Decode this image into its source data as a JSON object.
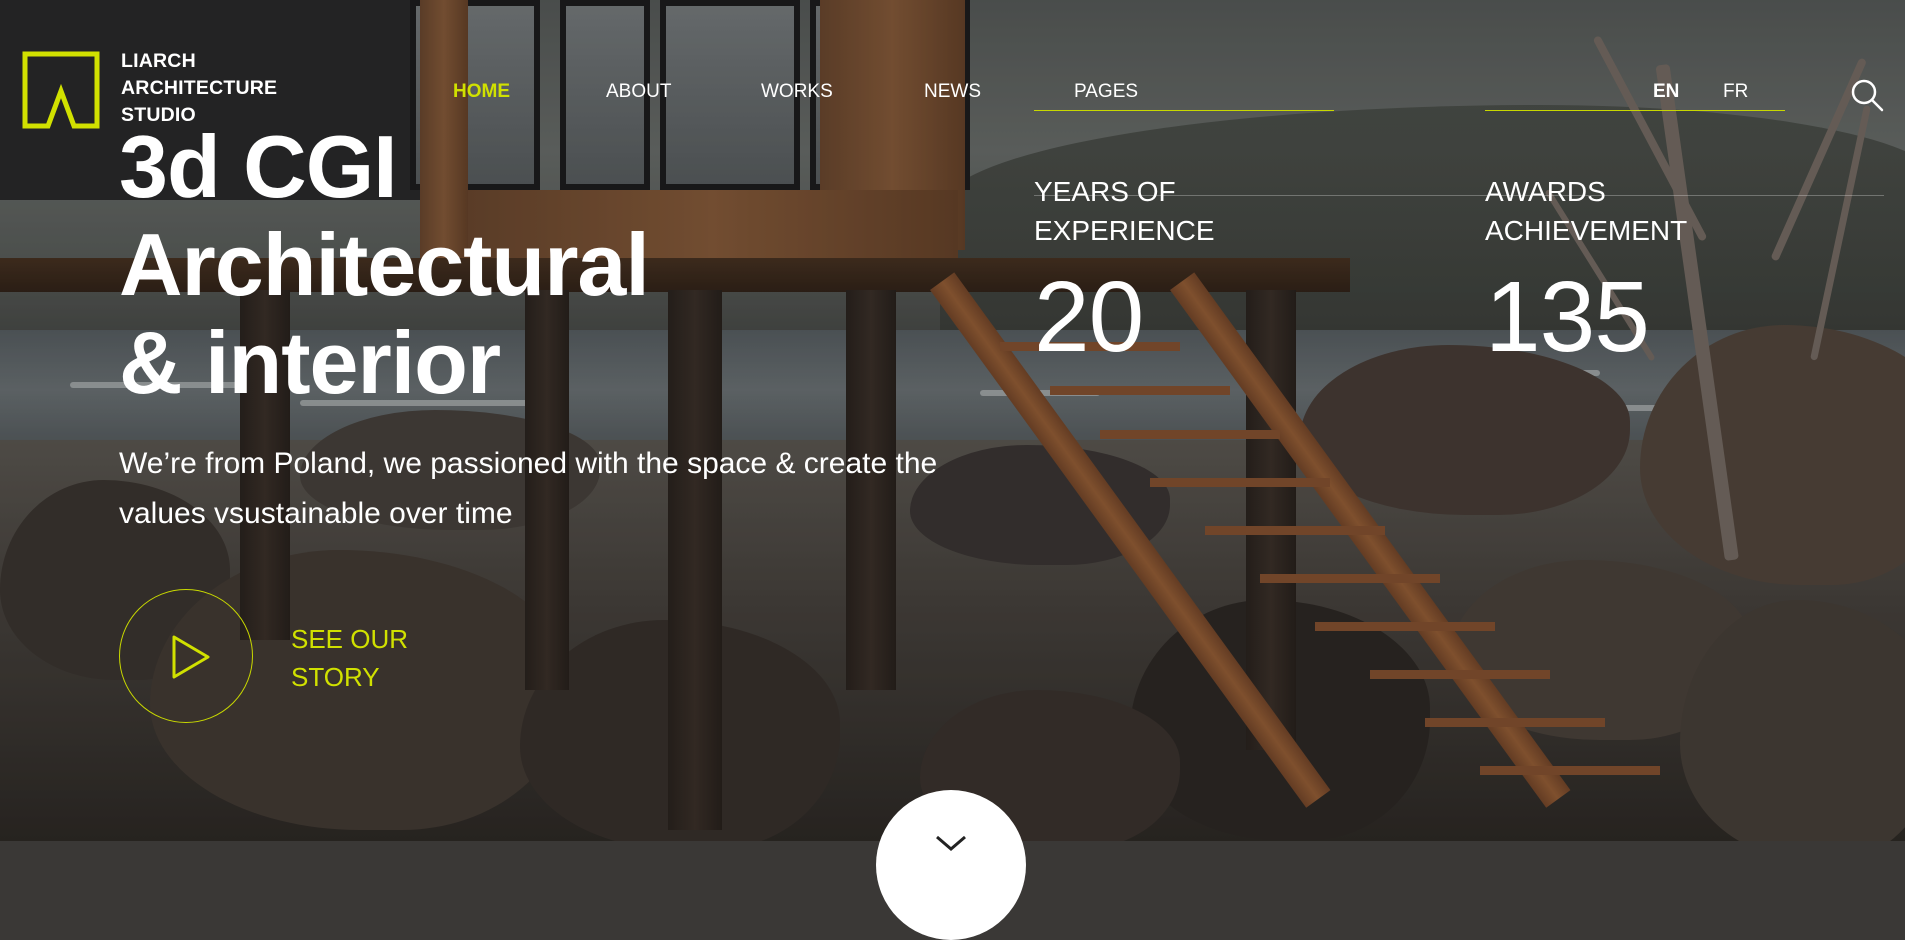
{
  "brand": {
    "name_lines": [
      "LIARCH",
      "ARCHITECTURE",
      "STUDIO"
    ],
    "accent_color": "#d1e100"
  },
  "nav": {
    "items": [
      {
        "label": "HOME",
        "active": true
      },
      {
        "label": "ABOUT",
        "active": false
      },
      {
        "label": "WORKS",
        "active": false
      },
      {
        "label": "NEWS",
        "active": false
      },
      {
        "label": "PAGES",
        "active": false
      }
    ]
  },
  "languages": [
    {
      "label": "EN",
      "active": true
    },
    {
      "label": "FR",
      "active": false
    }
  ],
  "search": {
    "icon": "search-icon"
  },
  "hero": {
    "title_lines": [
      "3d CGI",
      "Architectural",
      "& interior"
    ],
    "subtitle": "We’re from Poland, we passioned with the space & create the values vsustainable over time",
    "cta_lines": [
      "SEE OUR",
      "STORY"
    ],
    "cta_icon": "play-icon"
  },
  "stats": [
    {
      "label_lines": [
        "YEARS OF",
        "EXPERIENCE"
      ],
      "value": "20"
    },
    {
      "label_lines": [
        "AWARDS",
        "ACHIEVEMENT"
      ],
      "value": "135"
    }
  ],
  "scroll": {
    "icon": "chevron-down-icon"
  }
}
